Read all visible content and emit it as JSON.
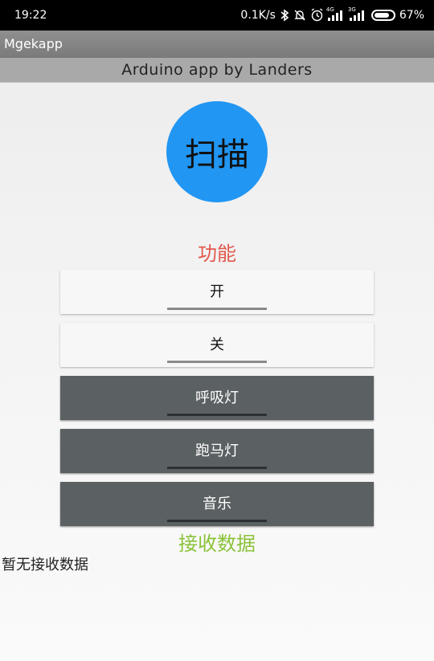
{
  "status": {
    "time": "19:22",
    "speed": "0.1K/s",
    "network1": "4G",
    "network2": "3G",
    "battery": "67%",
    "icons": [
      "bluetooth-icon",
      "mute-bell-icon",
      "alarm-icon",
      "signal-icon",
      "battery-icon"
    ]
  },
  "app": {
    "title": "Mgekapp",
    "subtitle": "Arduino app by Landers"
  },
  "scan_button": {
    "label": "扫描",
    "color": "#2196f3"
  },
  "function": {
    "title": "功能",
    "title_color": "#e2584c",
    "buttons": [
      {
        "label": "开",
        "style": "light"
      },
      {
        "label": "关",
        "style": "light"
      },
      {
        "label": "呼吸灯",
        "style": "dark"
      },
      {
        "label": "跑马灯",
        "style": "dark"
      },
      {
        "label": "音乐",
        "style": "dark"
      }
    ]
  },
  "receive": {
    "title": "接收数据",
    "title_color": "#8ac33a",
    "text": "暂无接收数据"
  }
}
